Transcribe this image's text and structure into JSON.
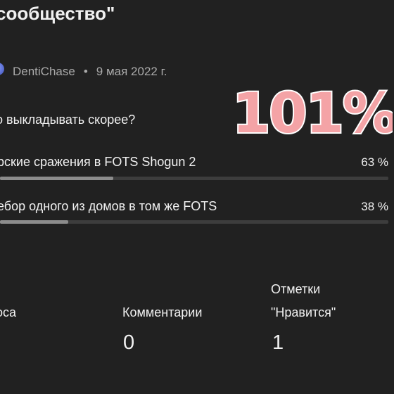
{
  "post": {
    "title": "сообщество\"",
    "author": "DentiChase",
    "separator": "•",
    "date": "9 мая 2022 г."
  },
  "poll": {
    "question": "о выкладывать скорее?",
    "options": [
      {
        "label": "рские сражения в FOTS Shogun 2",
        "percent_label": "63 %",
        "percent": 63
      },
      {
        "label": "ебор одного из домов в том же FOTS",
        "percent_label": "38 %",
        "percent": 38
      }
    ]
  },
  "overlay": {
    "badge_text": "101%"
  },
  "stats": {
    "votes": {
      "label": "оса"
    },
    "comments": {
      "label": "Комментарии",
      "value": "0"
    },
    "likes": {
      "label_line1": "Отметки",
      "label_line2": "\"Нравится\"",
      "value": "1"
    }
  },
  "colors": {
    "background": "#212121",
    "text": "#f1f1f1",
    "secondary_text": "#aaaaaa",
    "bar_track": "#3d3d3d",
    "bar_fill": "#8c8c8c",
    "badge_fill": "#f4a3a6"
  }
}
